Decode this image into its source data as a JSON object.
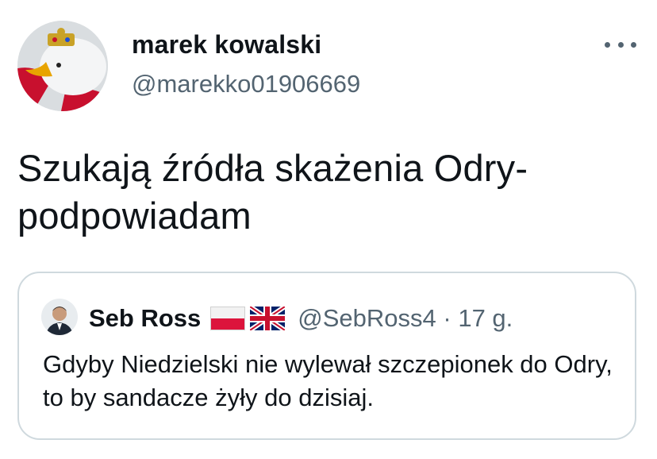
{
  "author": {
    "display_name": "marek kowalski",
    "handle": "@marekko01906669"
  },
  "tweet": {
    "text": "Szukają źródła skażenia Odry- podpowiadam"
  },
  "quoted_tweet": {
    "display_name": "Seb Ross",
    "flags": [
      "flag-poland-icon",
      "flag-uk-icon"
    ],
    "handle_and_time": "@SebRoss4 · 17 g.",
    "text": "Gdyby Niedzielski nie wylewał szczepionek do Odry, to by sandacze żyły do dzisiaj."
  },
  "colors": {
    "text": "#0f1419",
    "secondary": "#536471",
    "border": "#cfd9de"
  },
  "icons": {
    "more": "more-horizontal-icon"
  }
}
